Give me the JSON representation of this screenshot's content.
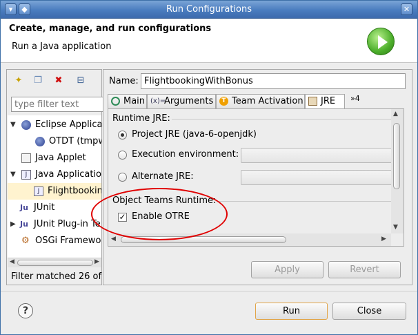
{
  "window": {
    "title": "Run Configurations"
  },
  "header": {
    "title": "Create, manage, and run configurations",
    "subtitle": "Run a Java application"
  },
  "left_panel": {
    "filter_placeholder": "type filter text",
    "tree": [
      {
        "label": "Eclipse Applica",
        "expanded": true,
        "icon": "eclipse-icon"
      },
      {
        "label": "OTDT (tmpw",
        "icon": "eclipse-icon"
      },
      {
        "label": "Java Applet",
        "icon": "applet-icon"
      },
      {
        "label": "Java Applicatio",
        "expanded": true,
        "icon": "java-app-icon"
      },
      {
        "label": "Flightbookin",
        "icon": "java-app-icon",
        "selected": true
      },
      {
        "label": "JUnit",
        "icon": "junit-icon"
      },
      {
        "label": "JUnit Plug-in Te",
        "collapsed": true,
        "icon": "junit-plugin-icon"
      },
      {
        "label": "OSGi Framewo",
        "icon": "osgi-icon"
      }
    ],
    "status": "Filter matched 26 of"
  },
  "right_panel": {
    "name_label": "Name:",
    "name_value": "FlightbookingWithBonus",
    "tabs": [
      {
        "label": "Main",
        "icon": "main-tab-icon"
      },
      {
        "label": "Arguments",
        "icon": "arguments-tab-icon"
      },
      {
        "label": "Team Activation",
        "icon": "team-activation-icon"
      },
      {
        "label": "JRE",
        "icon": "jre-icon",
        "active": true
      }
    ],
    "tab_overflow": "»4",
    "runtime_jre_label": "Runtime JRE:",
    "jre_options": [
      {
        "label": "Project JRE (java-6-openjdk)",
        "selected": true
      },
      {
        "label": "Execution environment:",
        "selected": false
      },
      {
        "label": "Alternate JRE:",
        "selected": false
      }
    ],
    "ot_runtime_label": "Object Teams Runtime:",
    "enable_otre_label": "Enable OTRE",
    "enable_otre_checked": true,
    "apply_label": "Apply",
    "revert_label": "Revert"
  },
  "footer": {
    "run_label": "Run",
    "close_label": "Close"
  }
}
